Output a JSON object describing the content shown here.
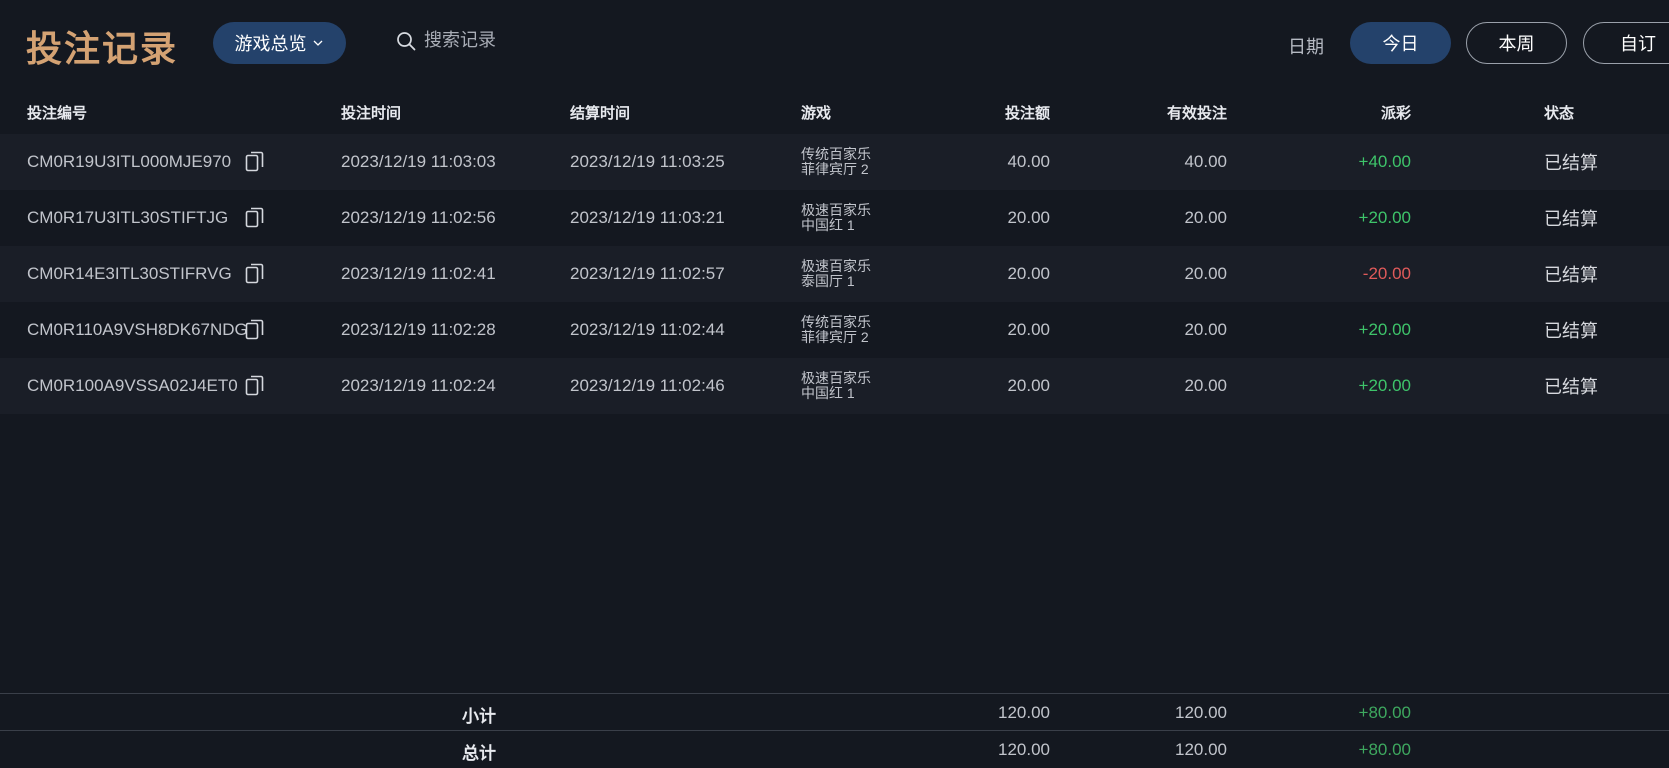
{
  "header": {
    "title": "投注记录",
    "game_filter": "游戏总览",
    "search_placeholder": "搜索记录",
    "date_label": "日期",
    "ranges": [
      "今日",
      "本周",
      "自订"
    ],
    "active_range": "今日",
    "accent": "#24426b",
    "title_color": "#d4a273"
  },
  "table": {
    "columns": [
      "投注编号",
      "投注时间",
      "结算时间",
      "游戏",
      "投注额",
      "有效投注",
      "派彩",
      "状态"
    ],
    "rows": [
      {
        "id": "CM0R19U3ITL000MJE970",
        "bet_time": "2023/12/19 11:03:03",
        "settle_time": "2023/12/19 11:03:25",
        "game": "传统百家乐",
        "table": "菲律宾厅 2",
        "amount": "40.00",
        "valid": "40.00",
        "payout": "+40.00",
        "status": "已结算"
      },
      {
        "id": "CM0R17U3ITL30STIFTJG",
        "bet_time": "2023/12/19 11:02:56",
        "settle_time": "2023/12/19 11:03:21",
        "game": "极速百家乐",
        "table": "中国红 1",
        "amount": "20.00",
        "valid": "20.00",
        "payout": "+20.00",
        "status": "已结算"
      },
      {
        "id": "CM0R14E3ITL30STIFRVG",
        "bet_time": "2023/12/19 11:02:41",
        "settle_time": "2023/12/19 11:02:57",
        "game": "极速百家乐",
        "table": "泰国厅 1",
        "amount": "20.00",
        "valid": "20.00",
        "payout": "-20.00",
        "status": "已结算"
      },
      {
        "id": "CM0R110A9VSH8DK67NDG",
        "bet_time": "2023/12/19 11:02:28",
        "settle_time": "2023/12/19 11:02:44",
        "game": "传统百家乐",
        "table": "菲律宾厅 2",
        "amount": "20.00",
        "valid": "20.00",
        "payout": "+20.00",
        "status": "已结算"
      },
      {
        "id": "CM0R100A9VSSA02J4ET0",
        "bet_time": "2023/12/19 11:02:24",
        "settle_time": "2023/12/19 11:02:46",
        "game": "极速百家乐",
        "table": "中国红 1",
        "amount": "20.00",
        "valid": "20.00",
        "payout": "+20.00",
        "status": "已结算"
      }
    ]
  },
  "footer": {
    "subtotal": {
      "label": "小计",
      "amount": "120.00",
      "valid": "120.00",
      "payout": "+80.00"
    },
    "total": {
      "label": "总计",
      "amount": "120.00",
      "valid": "120.00",
      "payout": "+80.00"
    }
  },
  "colors": {
    "positive": "#3ec46a",
    "negative": "#e05a5a",
    "background": "#141820"
  }
}
